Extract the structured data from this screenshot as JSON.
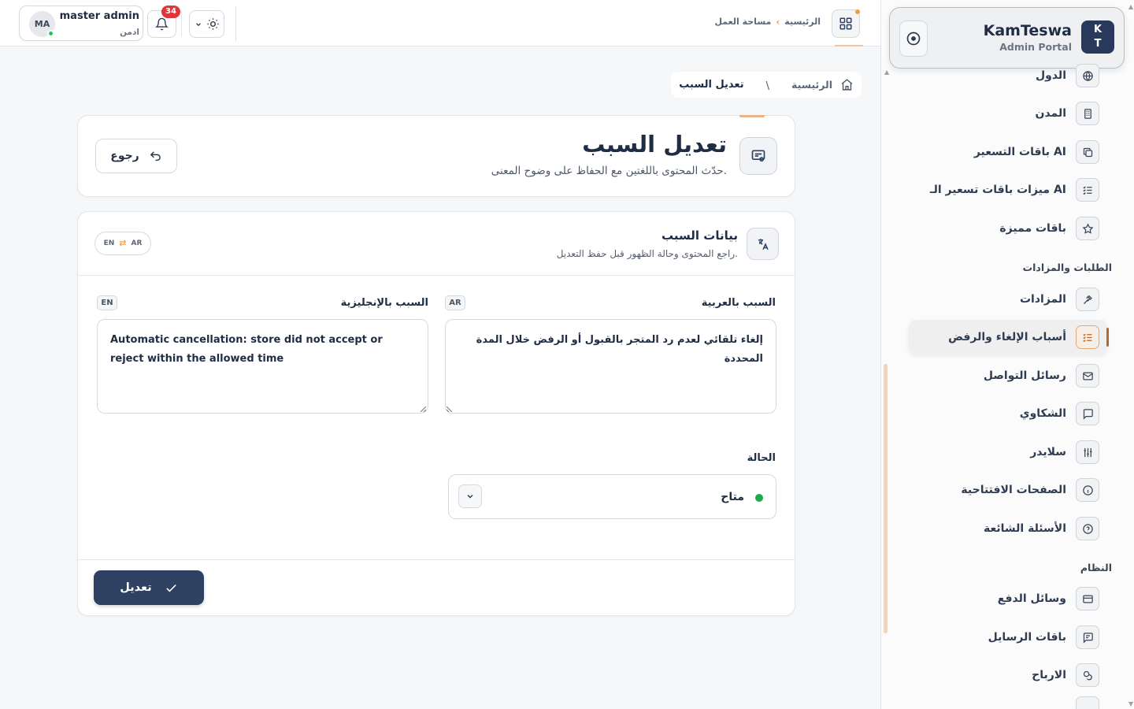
{
  "topbar": {
    "breadcrumb_home": "الرئيسية",
    "breadcrumb_current": "مساحة العمل",
    "notifications_count": "34",
    "user_initials": "MA",
    "user_name": "master admin",
    "user_role": "ادمن"
  },
  "sidebar": {
    "brand_name": "KamTeswa",
    "brand_sub": "Admin Portal",
    "brand_logo_line1": "K",
    "brand_logo_line2": "T",
    "items_top": [
      {
        "label": "الدول",
        "icon": "globe-icon"
      },
      {
        "label": "المدن",
        "icon": "building-icon"
      },
      {
        "label": "باقات التسعير AI",
        "icon": "copy-icon"
      },
      {
        "label": "ميزات باقات تسعير الـ AI",
        "icon": "list-check-icon"
      },
      {
        "label": "باقات مميزة",
        "icon": "star-icon"
      }
    ],
    "section_orders": "الطلبات والمزادات",
    "items_orders": [
      {
        "label": "المزادات",
        "icon": "gavel-icon"
      },
      {
        "label": "أسباب الإلغاء والرفض",
        "icon": "list-check-icon",
        "active": true
      },
      {
        "label": "رسائل التواصل",
        "icon": "mail-icon"
      },
      {
        "label": "الشكاوي",
        "icon": "message-square-icon"
      },
      {
        "label": "سلايدر",
        "icon": "sliders-icon"
      },
      {
        "label": "الصفحات الافتتاحية",
        "icon": "info-icon"
      },
      {
        "label": "الأسئلة الشائعة",
        "icon": "help-circle-icon"
      }
    ],
    "section_system": "النظام",
    "items_system": [
      {
        "label": "وسائل الدفع",
        "icon": "credit-card-icon"
      },
      {
        "label": "باقات الرسايل",
        "icon": "message-icon"
      },
      {
        "label": "الارباح",
        "icon": "coins-icon"
      }
    ]
  },
  "breadcrumb": {
    "home": "الرئيسية",
    "separator": "\\",
    "current": "تعديل السبب"
  },
  "header": {
    "title": "تعديل السبب",
    "subtitle": "حدّث المحتوى باللغتين مع الحفاظ على وضوح المعنى.",
    "back_label": "رجوع"
  },
  "form": {
    "title": "بيانات السبب",
    "subtitle": "راجع المحتوى وحالة الظهور قبل حفظ التعديل.",
    "lang_toggle_left": "EN",
    "lang_toggle_right": "AR",
    "ar_label": "السبب بالعربية",
    "ar_tag": "AR",
    "ar_value": "إلغاء تلقائي لعدم رد المتجر بالقبول أو الرفض خلال المدة المحددة",
    "en_label": "السبب بالإنجليزية",
    "en_tag": "EN",
    "en_value": "Automatic cancellation: store did not accept or reject within the allowed time",
    "status_label": "الحالة",
    "status_value": "متاح",
    "status_color": "#1faa4a",
    "submit_label": "تعديل"
  },
  "colors": {
    "primary": "#2e4163",
    "accent": "#f0a44c",
    "danger": "#e0363b",
    "success": "#22c55e"
  }
}
